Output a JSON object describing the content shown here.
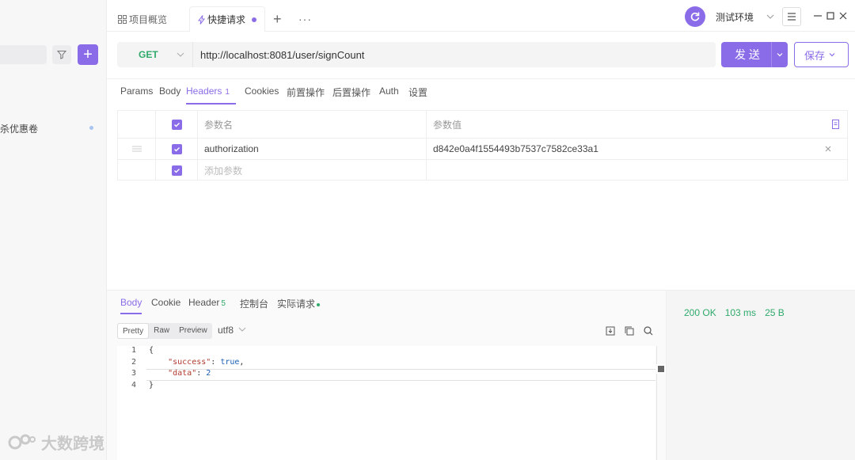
{
  "sidebar": {
    "item_label": "秒杀优惠卷",
    "add_label": "+"
  },
  "watermark": "大数跨境",
  "tabs": {
    "overview": "项目概览",
    "quick": "快捷请求",
    "plus": "+",
    "more": "···"
  },
  "env": {
    "name": "测试环境"
  },
  "request": {
    "method": "GET",
    "url": "http://localhost:8081/user/signCount",
    "send_label": "发 送",
    "save_label": "保存"
  },
  "req_tabs": [
    {
      "label": "Params"
    },
    {
      "label": "Body"
    },
    {
      "label": "Headers",
      "badge": "1"
    },
    {
      "label": "Cookies"
    },
    {
      "label": "前置操作"
    },
    {
      "label": "后置操作"
    },
    {
      "label": "Auth"
    },
    {
      "label": "设置"
    }
  ],
  "headers_table": {
    "col_name": "参数名",
    "col_value": "参数值",
    "rows": [
      {
        "name": "authorization",
        "value": "d842e0a4f1554493b7537c7582ce33a1"
      }
    ],
    "add_placeholder": "添加参数"
  },
  "response": {
    "tabs": [
      {
        "label": "Body"
      },
      {
        "label": "Cookie"
      },
      {
        "label": "Header",
        "badge": "5"
      },
      {
        "label": "控制台"
      },
      {
        "label": "实际请求"
      }
    ],
    "formats": [
      "Pretty",
      "Raw",
      "Preview"
    ],
    "encoding": "utf8",
    "lines": [
      "1",
      "2",
      "3",
      "4"
    ],
    "code": {
      "open": "{",
      "key_success": "\"success\"",
      "val_success": "true",
      "key_data": "\"data\"",
      "val_data": "2",
      "close": "}"
    },
    "status": "200 OK",
    "time": "103 ms",
    "size": "25 B"
  },
  "colors": {
    "accent": "#8b6ce8",
    "method_get": "#2faa6a",
    "status_ok": "#2faa6a"
  }
}
